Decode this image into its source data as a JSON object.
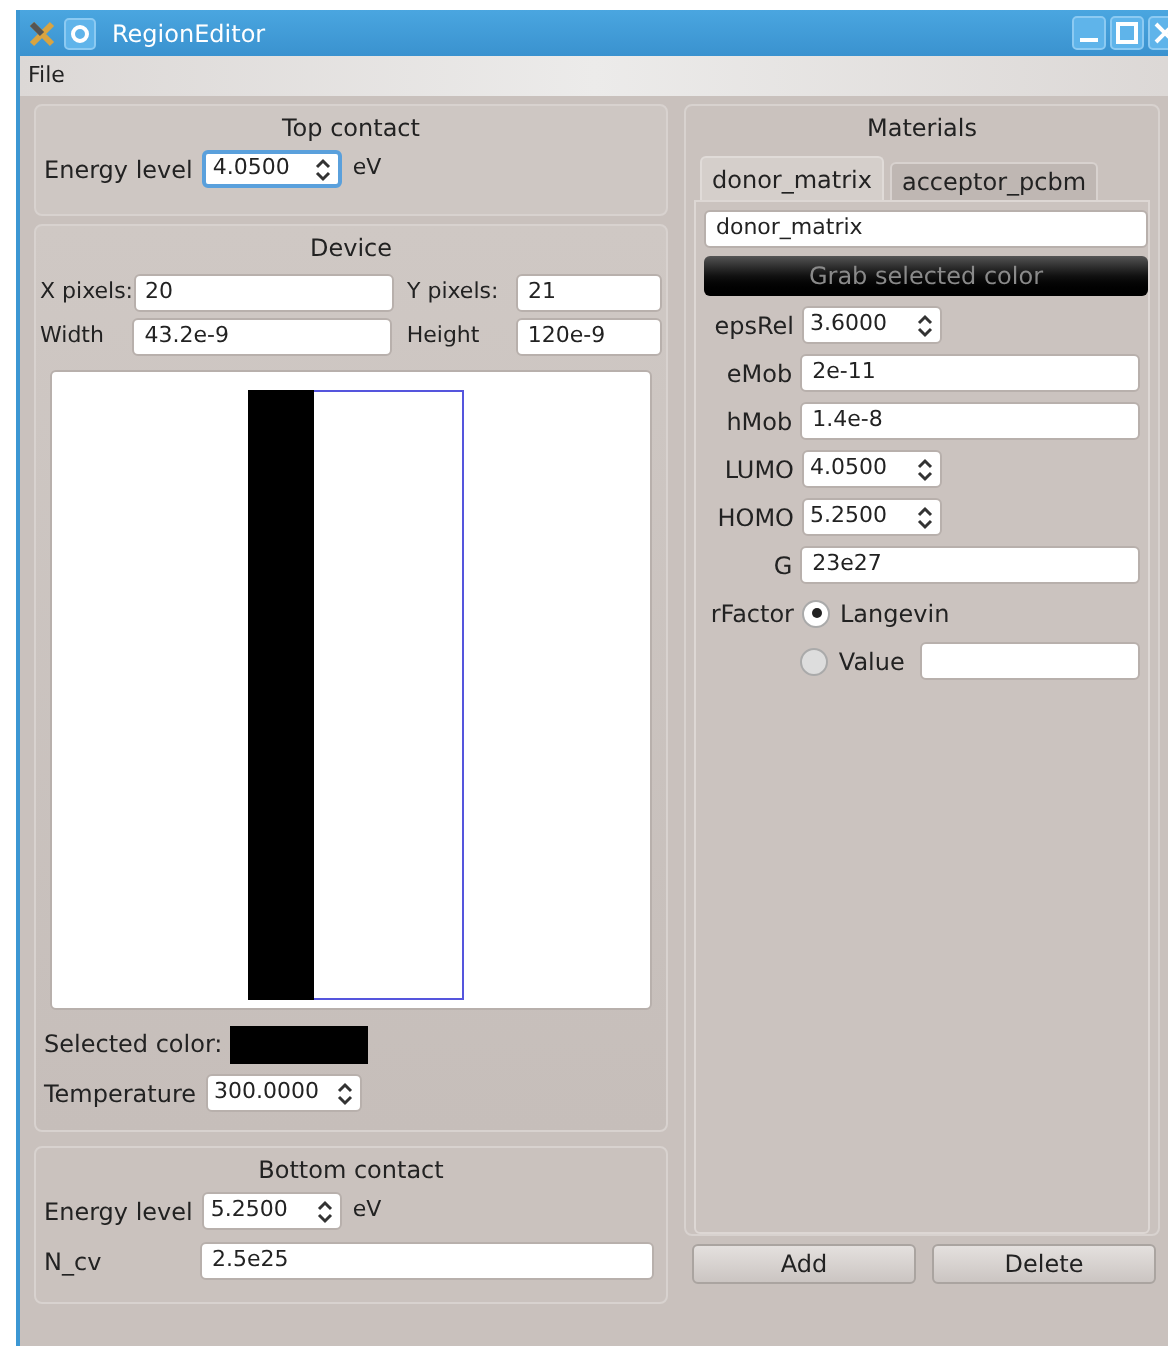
{
  "window": {
    "title": "RegionEditor"
  },
  "menu": [
    "File"
  ],
  "top_contact": {
    "title": "Top contact",
    "energy_label": "Energy level",
    "energy_value": "4.0500",
    "energy_focused": true,
    "unit": "eV"
  },
  "device": {
    "title": "Device",
    "x_label": "X pixels:",
    "x_value": "20",
    "y_label": "Y pixels:",
    "y_value": "21",
    "width_label": "Width",
    "width_value": "43.2e-9",
    "height_label": "Height",
    "height_value": "120e-9",
    "selected_color_label": "Selected color:",
    "temperature_label": "Temperature",
    "temperature_value": "300.0000"
  },
  "bottom_contact": {
    "title": "Bottom contact",
    "energy_label": "Energy level",
    "energy_value": "5.2500",
    "unit": "eV",
    "ncv_label": "N_cv",
    "ncv_value": "2.5e25"
  },
  "materials": {
    "title": "Materials",
    "tabs": [
      {
        "label": "donor_matrix",
        "selected": true
      },
      {
        "label": "acceptor_pcbm",
        "selected": false
      }
    ],
    "name_value": "donor_matrix",
    "grab_button": "Grab selected color",
    "fields": [
      {
        "kind": "spin",
        "label": "epsRel",
        "value": "3.6000"
      },
      {
        "kind": "text",
        "label": "eMob",
        "value": "2e-11"
      },
      {
        "kind": "text",
        "label": "hMob",
        "value": "1.4e-8"
      },
      {
        "kind": "spin",
        "label": "LUMO",
        "value": "4.0500"
      },
      {
        "kind": "spin",
        "label": "HOMO",
        "value": "5.2500"
      },
      {
        "kind": "text",
        "label": "G",
        "value": "23e27"
      }
    ],
    "rfactor": {
      "label": "rFactor",
      "options": [
        {
          "label": "Langevin",
          "selected": true
        },
        {
          "label": "Value",
          "selected": false,
          "has_field": true
        }
      ]
    }
  },
  "buttons": [
    "Add",
    "Delete"
  ]
}
